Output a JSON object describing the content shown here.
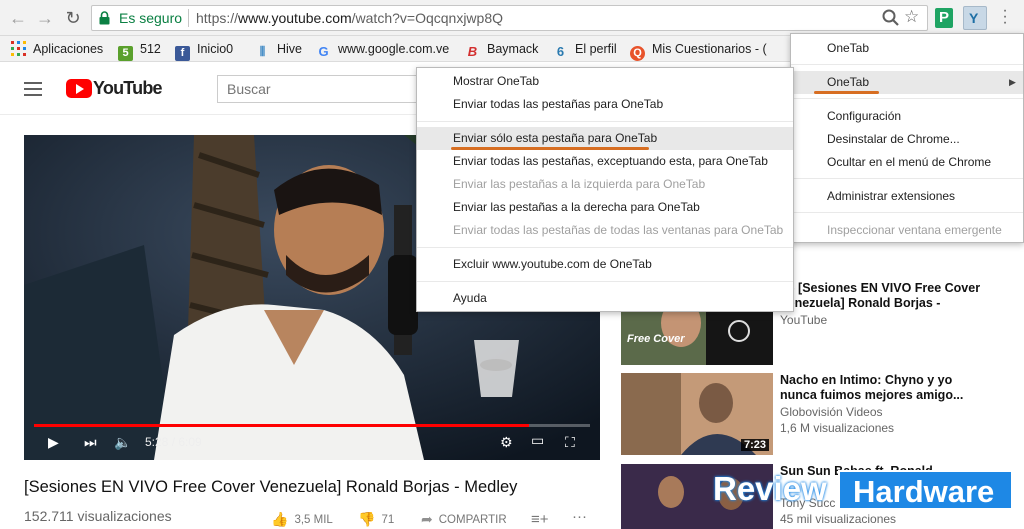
{
  "browser": {
    "security_label": "Es seguro",
    "url_prefix": "https://",
    "url_host": "www.youtube.com",
    "url_path": "/watch?v=Oqcqnxjwp8Q",
    "ext_p_label": "P",
    "ext_onetab_label": "Y"
  },
  "bookmarks": [
    {
      "label": "Aplicaciones",
      "icon": "apps-grid-icon",
      "color": "#4a4a4a"
    },
    {
      "label": "512",
      "icon": "five-icon",
      "color": "#5aa02c"
    },
    {
      "label": "Inicio0",
      "icon": "facebook-icon",
      "color": "#3b5998"
    },
    {
      "label": "Hive",
      "icon": "hive-icon",
      "color": "#4a90c8"
    },
    {
      "label": "www.google.com.ve",
      "icon": "google-icon",
      "color": "#4285f4"
    },
    {
      "label": "Baymack",
      "icon": "b-icon",
      "color": "#d32f2f"
    },
    {
      "label": "El perfil",
      "icon": "six-icon",
      "color": "#2a7ab0"
    },
    {
      "label": "Mis Cuestionarios - (",
      "icon": "quiz-icon",
      "color": "#e8532b"
    }
  ],
  "youtube": {
    "logo_text": "YouTube",
    "search_placeholder": "Buscar",
    "player": {
      "current_time": "5:28",
      "duration": "6:09",
      "time_display": "5:28 / 6:09",
      "progress": 0.89
    },
    "video_title": "[Sesiones EN VIVO Free Cover Venezuela] Ronald Borjas - Medley",
    "views": "152.711 visualizaciones",
    "likes": "3,5 MIL",
    "dislikes": "71",
    "share": "COMPARTIR"
  },
  "recommendations": [
    {
      "title": "x - [Sesiones EN VIVO Free Cover Venezuela] Ronald Borjas -",
      "channel": "YouTube",
      "views": "",
      "duration": "",
      "thumb_text": "Free Cover"
    },
    {
      "title": "Nacho en Intimo: Chyno y yo nunca fuimos mejores amigo...",
      "channel": "Globovisión Videos",
      "views": "1,6 M visualizaciones",
      "duration": "7:23",
      "thumb_text": ""
    },
    {
      "title": "Sun Sun Babae ft. Ronald",
      "channel": "Tony Succ",
      "views": "45 mil visualizaciones",
      "duration": "",
      "thumb_text": ""
    }
  ],
  "ext_menu": {
    "items": [
      {
        "label": "OneTab",
        "enabled": true
      },
      {
        "label": "OneTab",
        "enabled": true,
        "has_submenu": true,
        "highlighted": true
      },
      {
        "label": "Configuración",
        "enabled": true
      },
      {
        "label": "Desinstalar de Chrome...",
        "enabled": true
      },
      {
        "label": "Ocultar en el menú de Chrome",
        "enabled": true
      },
      {
        "label": "Administrar extensiones",
        "enabled": true
      },
      {
        "label": "Inspeccionar ventana emergente",
        "enabled": false
      }
    ],
    "submenu_arrow": "▶"
  },
  "onetab_menu": {
    "items": [
      {
        "label": "Mostrar OneTab",
        "enabled": true
      },
      {
        "label": "Enviar todas las pestañas para OneTab",
        "enabled": true
      },
      {
        "label": "Enviar sólo esta pestaña para OneTab",
        "enabled": true,
        "highlighted": true
      },
      {
        "label": "Enviar todas las pestañas, exceptuando esta, para OneTab",
        "enabled": true
      },
      {
        "label": "Enviar las pestañas a la izquierda para OneTab",
        "enabled": false
      },
      {
        "label": "Enviar las pestañas a la derecha para OneTab",
        "enabled": true
      },
      {
        "label": "Enviar todas las pestañas de todas las ventanas para OneTab",
        "enabled": false
      },
      {
        "label": "Excluir www.youtube.com de OneTab",
        "enabled": true
      },
      {
        "label": "Ayuda",
        "enabled": true
      }
    ]
  },
  "watermark": {
    "left": "Review",
    "right": "Hardware"
  },
  "colors": {
    "accent_underline": "#d76e22",
    "youtube_red": "#ff0000",
    "secure_green": "#0b8043",
    "watermark_blue": "#1e88e5"
  }
}
